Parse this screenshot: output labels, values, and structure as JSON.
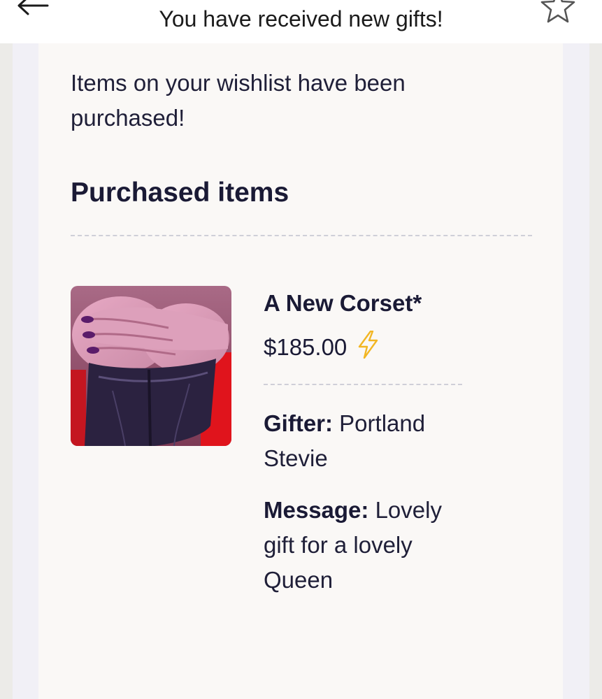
{
  "header": {
    "subject": "You have received new gifts!",
    "back_icon": "arrow-left-icon",
    "star_icon": "star-outline-icon"
  },
  "email": {
    "intro": "Items on your wishlist have been purchased!",
    "section_title": "Purchased items",
    "items": [
      {
        "name": "A New Corset*",
        "price": "$185.00",
        "price_icon": "lightning-bolt-icon",
        "gifter_label": "Gifter:",
        "gifter_value": "Portland Stevie",
        "message_label": "Message:",
        "message_value": "Lovely gift for a lovely Queen"
      }
    ]
  },
  "colors": {
    "card_bg": "#faf8f6",
    "frame_bg": "#f1f0f6",
    "text": "#1a1a35",
    "bolt": "#f2b623"
  }
}
